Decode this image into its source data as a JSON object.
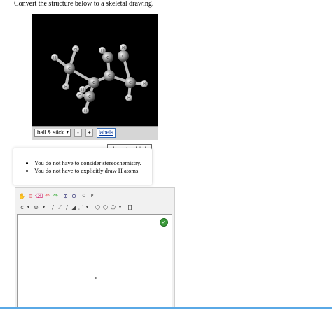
{
  "question": {
    "text": "Convert the structure below to a skeletal drawing."
  },
  "viewer": {
    "display_mode": "ball & stick",
    "zoom_out_label": "-",
    "zoom_in_label": "+",
    "labels_button": "labels",
    "labels_tooltip": "show atom labels",
    "atom_labels": {
      "hydrogen": "H",
      "carbon": "C"
    }
  },
  "notes": {
    "items": [
      "You do not have to consider stereochemistry.",
      "You do not have to explicitly draw H atoms."
    ]
  },
  "editor": {
    "toolbar_row1": [
      "hand-icon",
      "lasso-icon",
      "eraser-icon",
      "undo-icon",
      "redo-icon",
      "zoom-in-icon",
      "zoom-out-icon",
      "clean-icon",
      "info-icon"
    ],
    "clean_label": "C",
    "info_label": "P",
    "toolbar_row2": [
      "charge-icon",
      "atom-dropdown",
      "single-bond-icon",
      "double-bond-icon",
      "triple-bond-icon",
      "wedge-bond-icon",
      "hash-bond-icon",
      "bond-dropdown",
      "ring-benzene-icon",
      "ring-cyclohexane-icon",
      "ring-pentagon-icon",
      "ring-dropdown",
      "bracket-icon"
    ],
    "check_icon": "check-icon"
  }
}
